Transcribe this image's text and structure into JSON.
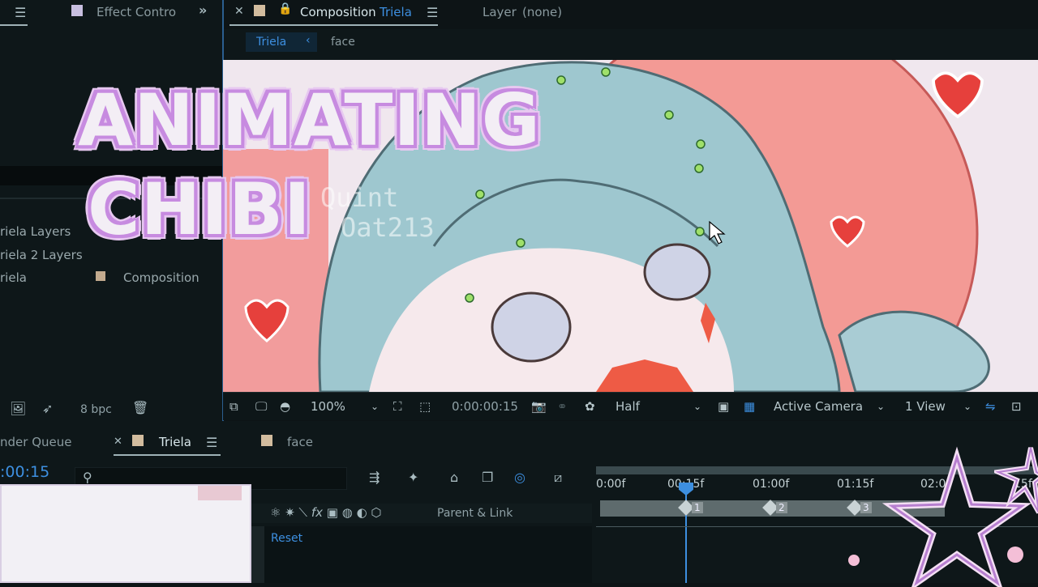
{
  "left_panel": {
    "effect_controls_tab": "Effect Contro",
    "layers": [
      {
        "label": "riela Layers"
      },
      {
        "label": "riela 2 Layers"
      },
      {
        "label": "riela",
        "type": "Composition"
      }
    ],
    "footer": {
      "bpc": "8 bpc"
    }
  },
  "comp_panel": {
    "tab_label": "Composition",
    "comp_name": "Triela",
    "layer_tab": "Layer",
    "layer_value": "(none)",
    "breadcrumbs": [
      "Triela",
      "face"
    ]
  },
  "viewer_controls": {
    "zoom": "100%",
    "timecode": "0:00:00:15",
    "resolution": "Half",
    "camera": "Active Camera",
    "views": "1 View"
  },
  "overlay": {
    "line1": "ANIMATING",
    "line2": "CHIBI",
    "watermark1": "Quint",
    "watermark2": "Oat213"
  },
  "timeline": {
    "render_queue_tab": "nder Queue",
    "comp_tab": "Triela",
    "face_tab": "face",
    "current_time": ":00:15",
    "parent_link_header": "Parent & Link",
    "reset_label": "Reset",
    "ruler": [
      "0:00f",
      "00:15f",
      "01:00f",
      "01:15f",
      "02:0",
      "15f"
    ],
    "keyframes": [
      "1",
      "2",
      "3"
    ]
  },
  "colors": {
    "accent_blue": "#3d8fe0",
    "title_outline": "#c78be0",
    "bg_dark": "#0d1416"
  }
}
